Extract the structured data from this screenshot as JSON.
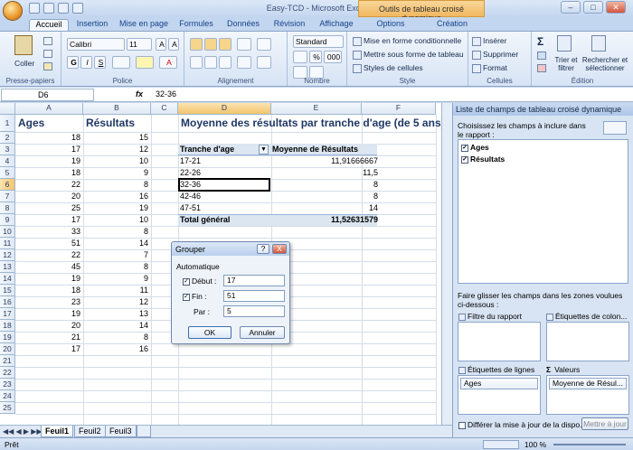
{
  "window": {
    "title": "Easy-TCD - Microsoft Excel",
    "context_tab": "Outils de tableau croisé dynamique"
  },
  "tabs": [
    "Accueil",
    "Insertion",
    "Mise en page",
    "Formules",
    "Données",
    "Révision",
    "Affichage",
    "Options",
    "Création"
  ],
  "ribbon": {
    "clipboard": {
      "paste": "Coller",
      "label": "Presse-papiers"
    },
    "font": {
      "name": "Calibri",
      "size": "11",
      "label": "Police",
      "bold": "G",
      "italic": "I",
      "underline": "S"
    },
    "alignment": {
      "label": "Alignement"
    },
    "number": {
      "format": "Standard",
      "label": "Nombre",
      "percent": "%",
      "thousands": "000"
    },
    "style": {
      "cond": "Mise en forme conditionnelle",
      "table": "Mettre sous forme de tableau",
      "cell": "Styles de cellules",
      "label": "Style"
    },
    "cells": {
      "insert": "Insérer",
      "delete": "Supprimer",
      "format": "Format",
      "label": "Cellules"
    },
    "edit": {
      "sum": "Σ",
      "sort": "Trier et filtrer",
      "find": "Rechercher et sélectionner",
      "label": "Édition"
    }
  },
  "formula_bar": {
    "name": "D6",
    "fx": "fx",
    "value": "32-36"
  },
  "columns": [
    "A",
    "B",
    "C",
    "D",
    "E",
    "F"
  ],
  "rows": [
    "1",
    "2",
    "3",
    "4",
    "5",
    "6",
    "7",
    "8",
    "9",
    "10",
    "11",
    "12",
    "13",
    "14",
    "15",
    "16",
    "17",
    "18",
    "19",
    "20",
    "21",
    "22",
    "23",
    "24",
    "25"
  ],
  "data": {
    "header_a": "Ages",
    "header_b": "Résultats",
    "ages": [
      "18",
      "17",
      "19",
      "18",
      "22",
      "20",
      "25",
      "17",
      "33",
      "51",
      "22",
      "45",
      "19",
      "18",
      "23",
      "19",
      "20",
      "21",
      "17"
    ],
    "results": [
      "15",
      "12",
      "10",
      "9",
      "8",
      "16",
      "19",
      "10",
      "8",
      "14",
      "7",
      "8",
      "9",
      "11",
      "12",
      "13",
      "14",
      "8",
      "16"
    ]
  },
  "pivot": {
    "title": "Moyenne des résultats par tranche d'age (de 5 ans)",
    "col1": "Tranche d'age",
    "col2": "Moyenne de Résultats",
    "rows": [
      {
        "k": "17-21",
        "v": "11,91666667"
      },
      {
        "k": "22-26",
        "v": "11,5"
      },
      {
        "k": "32-36",
        "v": "8"
      },
      {
        "k": "42-46",
        "v": "8"
      },
      {
        "k": "47-51",
        "v": "14"
      }
    ],
    "total_label": "Total général",
    "total_value": "11,52631579"
  },
  "sheet_tabs": [
    "Feuil1",
    "Feuil2",
    "Feuil3"
  ],
  "status": {
    "ready": "Prêt",
    "zoom": "100 %"
  },
  "panel": {
    "title": "Liste de champs de tableau croisé dynamique",
    "choose": "Choisissez les champs à inclure dans le rapport :",
    "fields": [
      "Ages",
      "Résultats"
    ],
    "drag": "Faire glisser les champs dans les zones voulues ci-dessous :",
    "zone_filter": "Filtre du rapport",
    "zone_cols": "Étiquettes de colon...",
    "zone_rows": "Étiquettes de lignes",
    "zone_values": "Valeurs",
    "row_field": "Ages",
    "value_field": "Moyenne de Résul...",
    "defer": "Différer la mise à jour de la dispo...",
    "update": "Mettre à jour"
  },
  "dialog": {
    "title": "Grouper",
    "help": "?",
    "close": "X",
    "auto": "Automatique",
    "start_label": "Début :",
    "end_label": "Fin :",
    "by_label": "Par :",
    "start": "17",
    "end": "51",
    "by": "5",
    "ok": "OK",
    "cancel": "Annuler"
  }
}
